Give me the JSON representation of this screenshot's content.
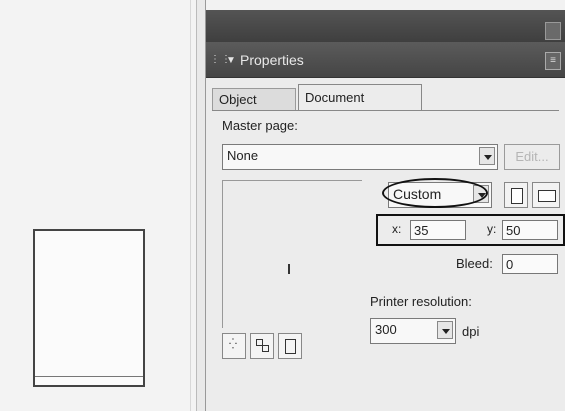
{
  "panel": {
    "title": "Properties",
    "menu_icon": "panel-menu-icon",
    "tabs": [
      {
        "label": "Object"
      },
      {
        "label": "Document"
      }
    ]
  },
  "document": {
    "master_page_label": "Master page:",
    "master_page_value": "None",
    "edit_button": "Edit...",
    "page_size_value": "Custom",
    "x_label": "x:",
    "x_value": "35",
    "y_label": "y:",
    "y_value": "50",
    "bleed_label": "Bleed:",
    "bleed_value": "0",
    "printer_resolution_label": "Printer resolution:",
    "printer_resolution_value": "300",
    "dpi_label": "dpi"
  }
}
